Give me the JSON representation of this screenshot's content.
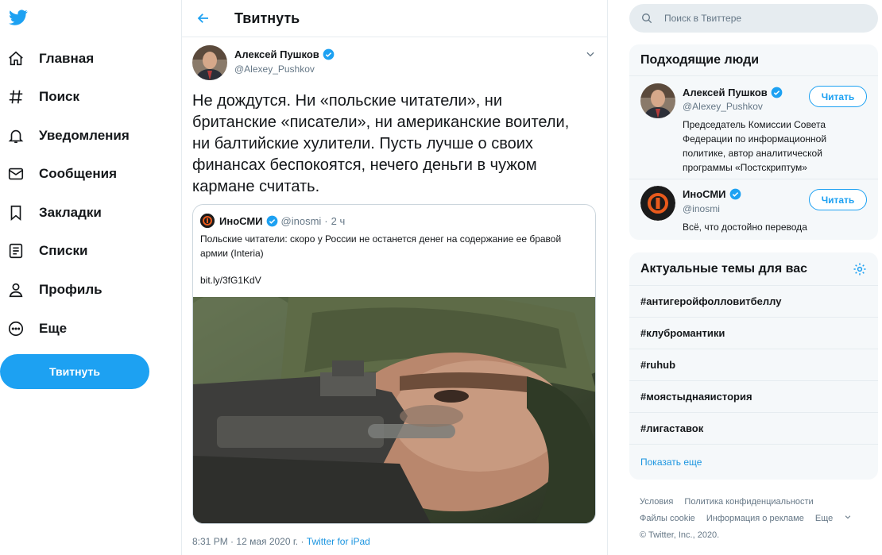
{
  "colors": {
    "accent": "#1da1f2",
    "link": "#1b95e0",
    "text": "#14171a",
    "muted": "#657786"
  },
  "sidebar": {
    "logo_icon": "twitter-bird-icon",
    "items": [
      {
        "label": "Главная",
        "icon": "home-icon"
      },
      {
        "label": "Поиск",
        "icon": "hashtag-icon"
      },
      {
        "label": "Уведомления",
        "icon": "bell-icon"
      },
      {
        "label": "Сообщения",
        "icon": "envelope-icon"
      },
      {
        "label": "Закладки",
        "icon": "bookmark-icon"
      },
      {
        "label": "Списки",
        "icon": "list-icon"
      },
      {
        "label": "Профиль",
        "icon": "person-icon"
      },
      {
        "label": "Еще",
        "icon": "more-icon"
      }
    ],
    "tweet_button": "Твитнуть"
  },
  "main": {
    "title": "Твитнуть",
    "tweet": {
      "author_name": "Алексей Пушков",
      "author_handle": "@Alexey_Pushkov",
      "text": "Не дождутся. Ни «польские читатели», ни британские «писатели», ни американские воители, ни балтийские хулители. Пусть лучше о своих финансах беспокоятся, нечего деньги в чужом кармане считать.",
      "quote": {
        "name": "ИноСМИ",
        "handle": "@inosmi",
        "separator": "·",
        "time": "2 ч",
        "text": "Польские читатели: скоро у России не останется денег на содержание ее бравой армии (Interia)",
        "link": "bit.ly/3fG1KdV"
      },
      "time": "8:31 PM",
      "dot": "·",
      "date": "12 мая 2020 г.",
      "source": "Twitter for iPad"
    }
  },
  "right": {
    "search": {
      "placeholder": "Поиск в Твиттере"
    },
    "who_to_follow": {
      "title": "Подходящие люди",
      "people": [
        {
          "name": "Алексей Пушков",
          "handle": "@Alexey_Pushkov",
          "bio": "Председатель Комиссии Совета Федерации по информационной политике, автор аналитической программы «Постскриптум»",
          "follow_label": "Читать"
        },
        {
          "name": "ИноСМИ",
          "handle": "@inosmi",
          "bio": "Всё, что достойно перевода",
          "follow_label": "Читать"
        }
      ]
    },
    "trends": {
      "title": "Актуальные темы для вас",
      "items": [
        "#антигеройфолловитбеллу",
        "#клубромантики",
        "#ruhub",
        "#моястыднаяистория",
        "#лигаставок"
      ],
      "show_more": "Показать еще"
    },
    "footer": {
      "links": [
        "Условия",
        "Политика конфиденциальности",
        "Файлы cookie",
        "Информация о рекламе",
        "Еще"
      ],
      "copyright": "© Twitter, Inc., 2020."
    }
  }
}
